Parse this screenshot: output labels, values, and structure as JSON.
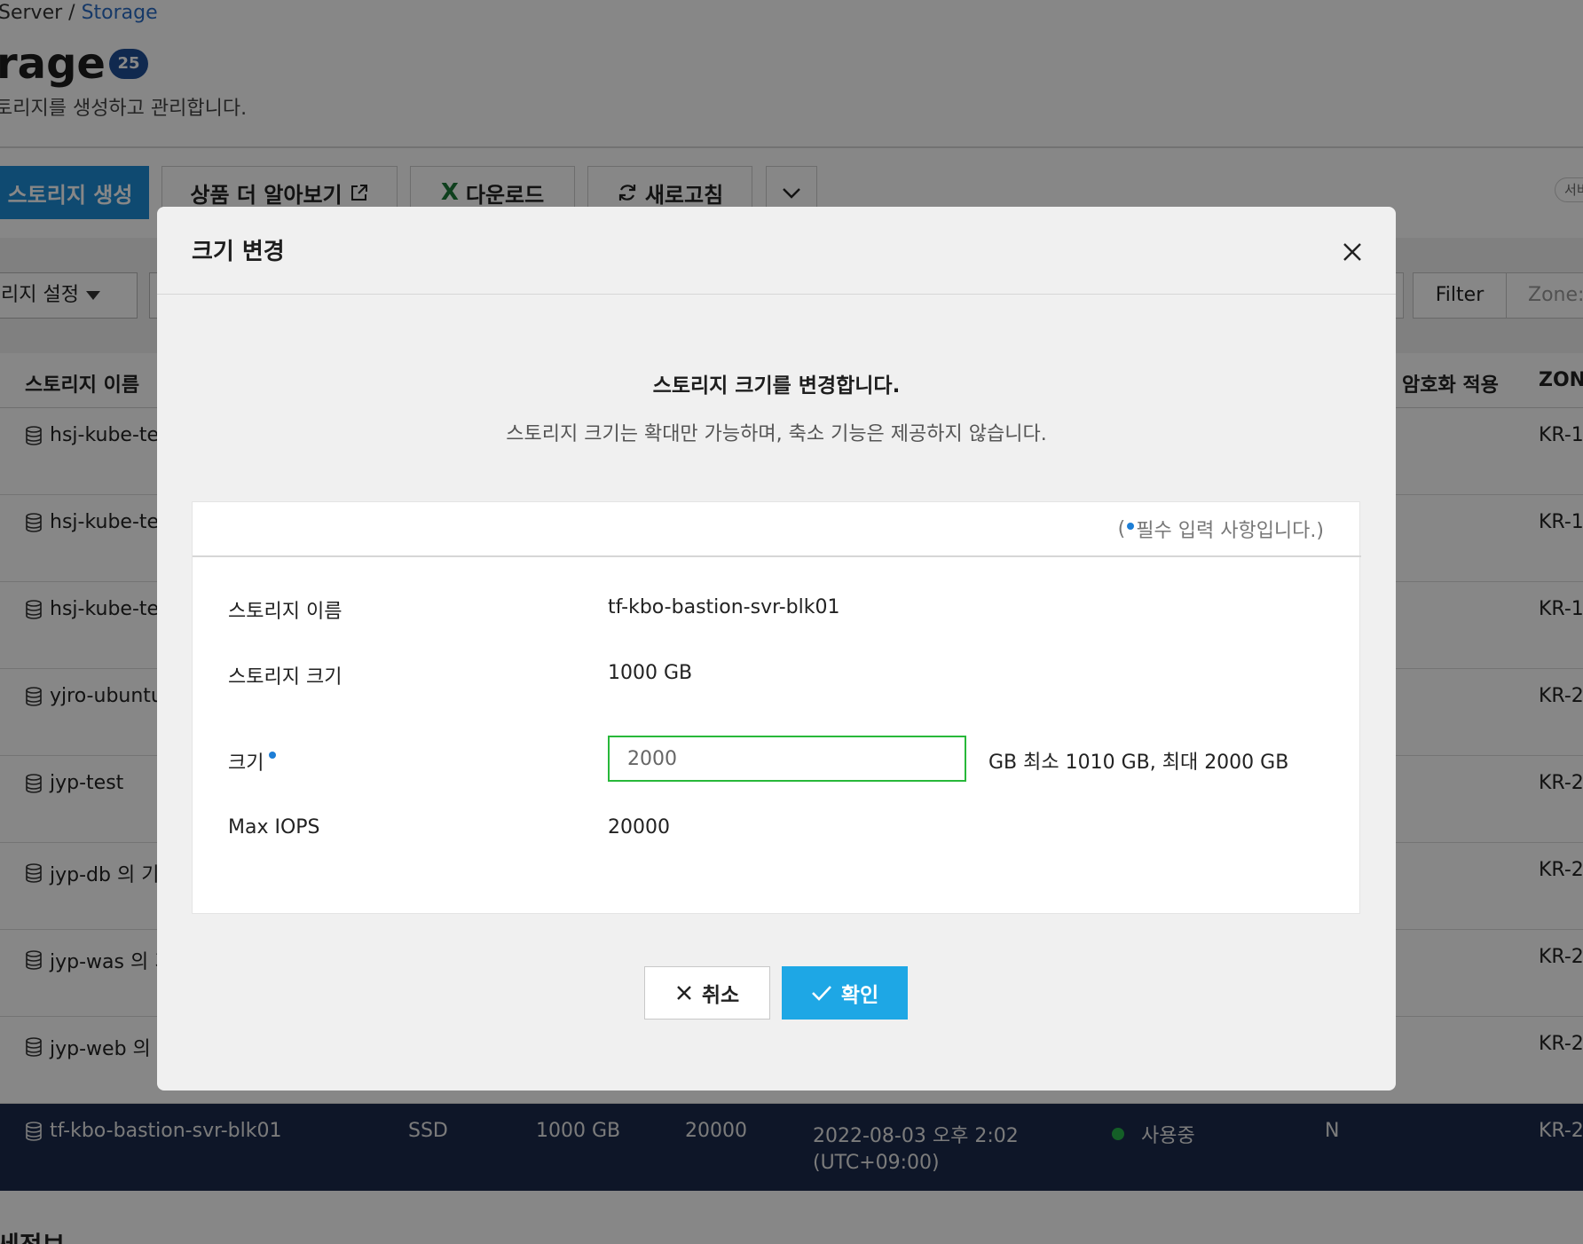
{
  "background": {
    "breadcrumb": {
      "prefix": "Server /",
      "current": "Storage"
    },
    "page_title": "rage",
    "count_badge": "25",
    "page_desc": "토리지를 생성하고 관리합니다.",
    "toolbar": {
      "create_label": "스토리지 생성",
      "learn_more_label": "상품 더 알아보기",
      "download_label": "다운로드",
      "refresh_label": "새로고침",
      "right_pill": "서비"
    },
    "filter_bar": {
      "settings_select": "리지 설정",
      "filter_label": "Filter",
      "zone_placeholder": "Zone:"
    },
    "table": {
      "columns": {
        "name": "스토리지 이름",
        "encryption": "암호화 적용",
        "zone": "ZONE"
      },
      "rows": [
        {
          "name": "hsj-kube-tes",
          "zone": "KR-1"
        },
        {
          "name": "hsj-kube-tes",
          "zone": "KR-1"
        },
        {
          "name": "hsj-kube-tes",
          "zone": "KR-1"
        },
        {
          "name": "yjro-ubuntu",
          "zone": "KR-2"
        },
        {
          "name": "jyp-test",
          "zone": "KR-2"
        },
        {
          "name": "jyp-db 의 기",
          "zone": "KR-2"
        },
        {
          "name": "jyp-was 의 기",
          "zone": "KR-2"
        },
        {
          "name": "jyp-web 의 기",
          "zone": "KR-2"
        }
      ],
      "selected_row": {
        "name": "tf-kbo-bastion-svr-blk01",
        "type": "SSD",
        "size": "1000 GB",
        "iops": "20000",
        "created_date": "2022-08-03 오후 2:02",
        "created_tz": "(UTC+09:00)",
        "status": "사용중",
        "encryption": "N",
        "zone": "KR-2"
      }
    },
    "detail_section_title": "세정보"
  },
  "modal": {
    "title": "크기 변경",
    "intro_title": "스토리지 크기를 변경합니다.",
    "intro_desc": "스토리지 크기는 확대만 가능하며, 축소 기능은 제공하지 않습니다.",
    "required_note_open": "(",
    "required_note_text": "필수 입력 사항입니다.)",
    "fields": {
      "name_label": "스토리지 이름",
      "name_value": "tf-kbo-bastion-svr-blk01",
      "current_size_label": "스토리지 크기",
      "current_size_value": "1000 GB",
      "size_label": "크기",
      "size_input_value": "2000",
      "size_hint": "GB 최소 1010 GB, 최대 2000 GB",
      "max_iops_label": "Max IOPS",
      "max_iops_value": "20000"
    },
    "cancel_label": "취소",
    "confirm_label": "확인"
  },
  "colors": {
    "primary_button": "#1d8cd6",
    "confirm_button": "#1ea7e5",
    "input_focus_border": "#28b83a",
    "selected_row": "#1b2b4c",
    "badge": "#1f4e96",
    "required_dot": "#1d7ed6",
    "status_dot": "#27b34a"
  }
}
